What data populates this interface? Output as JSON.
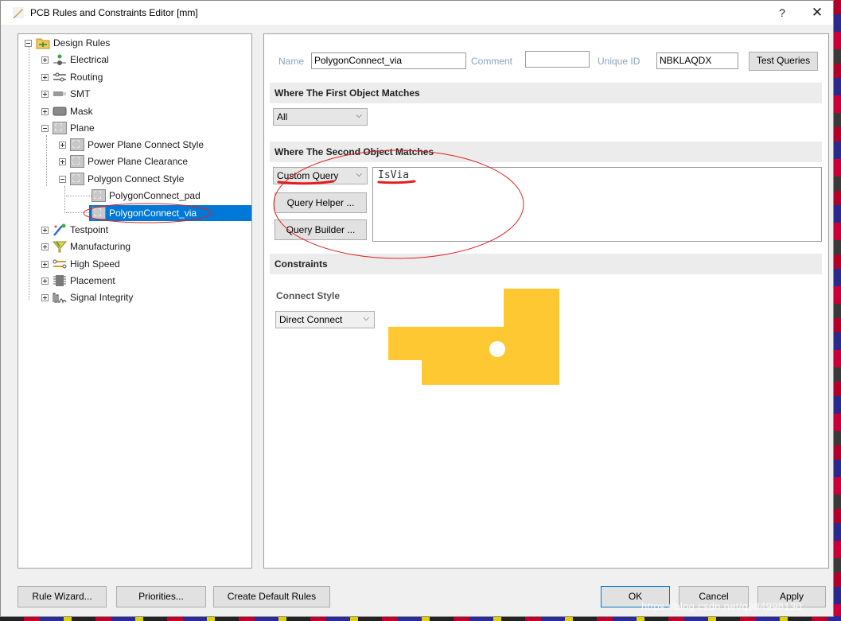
{
  "window": {
    "title": "PCB Rules and Constraints Editor [mm]",
    "help_label": "?",
    "close_label": "✕"
  },
  "tree": {
    "root": "Design Rules",
    "items": [
      {
        "label": "Electrical",
        "icon": "electrical-icon"
      },
      {
        "label": "Routing",
        "icon": "routing-icon"
      },
      {
        "label": "SMT",
        "icon": "smt-icon"
      },
      {
        "label": "Mask",
        "icon": "mask-icon"
      },
      {
        "label": "Plane",
        "icon": "plane-icon"
      },
      {
        "label": "Power Plane Connect Style",
        "icon": "plane-rule-icon"
      },
      {
        "label": "Power Plane Clearance",
        "icon": "plane-rule-icon"
      },
      {
        "label": "Polygon Connect Style",
        "icon": "plane-rule-icon"
      },
      {
        "label": "PolygonConnect_pad",
        "icon": "plane-rule-icon"
      },
      {
        "label": "PolygonConnect_via",
        "icon": "plane-rule-icon",
        "selected": true
      },
      {
        "label": "Testpoint",
        "icon": "testpoint-icon"
      },
      {
        "label": "Manufacturing",
        "icon": "manufacturing-icon"
      },
      {
        "label": "High Speed",
        "icon": "high-speed-icon"
      },
      {
        "label": "Placement",
        "icon": "placement-icon"
      },
      {
        "label": "Signal Integrity",
        "icon": "signal-integrity-icon"
      }
    ]
  },
  "rule": {
    "name_label": "Name",
    "name_value": "PolygonConnect_via",
    "comment_label": "Comment",
    "comment_value": "",
    "unique_id_label": "Unique ID",
    "unique_id_value": "NBKLAQDX",
    "test_queries_label": "Test Queries"
  },
  "first_match": {
    "heading": "Where The First Object Matches",
    "selected": "All"
  },
  "second_match": {
    "heading": "Where The Second Object Matches",
    "selected": "Custom Query",
    "query_helper_label": "Query Helper ...",
    "query_builder_label": "Query Builder ...",
    "query_text": "IsVia"
  },
  "constraints": {
    "heading": "Constraints",
    "connect_style_label": "Connect Style",
    "connect_style_value": "Direct Connect"
  },
  "footer": {
    "rule_wizard": "Rule Wizard...",
    "priorities": "Priorities...",
    "create_default_rules": "Create Default Rules",
    "ok": "OK",
    "cancel": "Cancel",
    "apply": "Apply"
  },
  "watermark": "https://blog.csdn.net/q384998130",
  "colors": {
    "selection": "#0078d7",
    "copper": "#fec832",
    "annotation": "#e02020"
  }
}
